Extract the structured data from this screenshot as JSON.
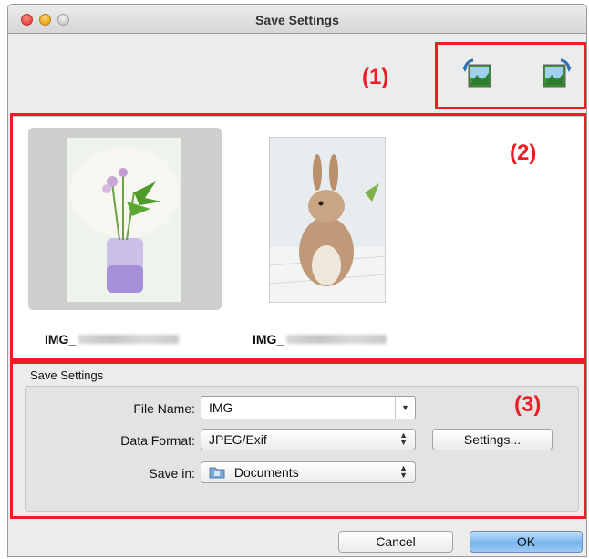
{
  "window": {
    "title": "Save Settings"
  },
  "callouts": {
    "one": "(1)",
    "two": "(2)",
    "three": "(3)"
  },
  "toolbar": {
    "rotate_left_icon": "rotate-left-icon",
    "rotate_right_icon": "rotate-right-icon"
  },
  "thumbnails": [
    {
      "caption": "IMG_",
      "selected": true,
      "icon": "flower-vase-photo"
    },
    {
      "caption": "IMG_",
      "selected": false,
      "icon": "rabbit-photo"
    }
  ],
  "save_settings": {
    "group_title": "Save Settings",
    "file_name_label": "File Name:",
    "file_name_value": "IMG",
    "data_format_label": "Data Format:",
    "data_format_value": "JPEG/Exif",
    "settings_button": "Settings...",
    "save_in_label": "Save in:",
    "save_in_value": "Documents"
  },
  "footer": {
    "cancel": "Cancel",
    "ok": "OK"
  },
  "colors": {
    "callout_red": "#ee1c24",
    "default_button_blue": "#76b5ee"
  }
}
